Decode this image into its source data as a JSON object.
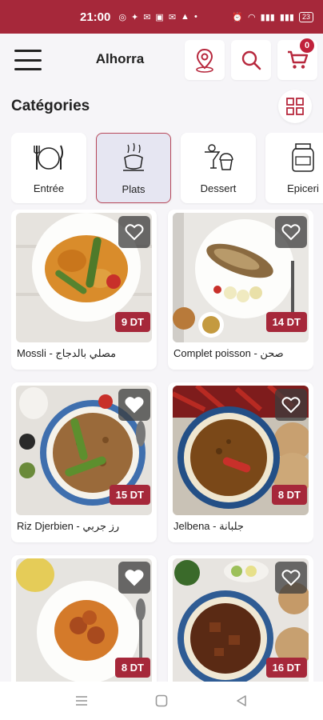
{
  "status": {
    "time": "21:00",
    "battery": "23"
  },
  "header": {
    "title": "Alhorra"
  },
  "cart": {
    "count": "0"
  },
  "categories_title": "Catégories",
  "categories": [
    {
      "label": "Entrée",
      "icon": "utensils-icon"
    },
    {
      "label": "Plats",
      "icon": "cooking-pot-icon",
      "active": true
    },
    {
      "label": "Dessert",
      "icon": "dessert-icon"
    },
    {
      "label": "Epiceri",
      "icon": "jar-icon"
    }
  ],
  "products": [
    {
      "name": "Mossli - مصلي بالدجاج",
      "price": "9 DT"
    },
    {
      "name": "Complet poisson - صحن",
      "price": "14 DT"
    },
    {
      "name": "Riz Djerbien - رز جربي",
      "price": "15 DT"
    },
    {
      "name": "Jelbena - جلبانة",
      "price": "8 DT"
    },
    {
      "name": "",
      "price": "8 DT"
    },
    {
      "name": "",
      "price": "16 DT"
    }
  ],
  "colors": {
    "primary": "#a6283a",
    "background": "#f6f5f8"
  }
}
